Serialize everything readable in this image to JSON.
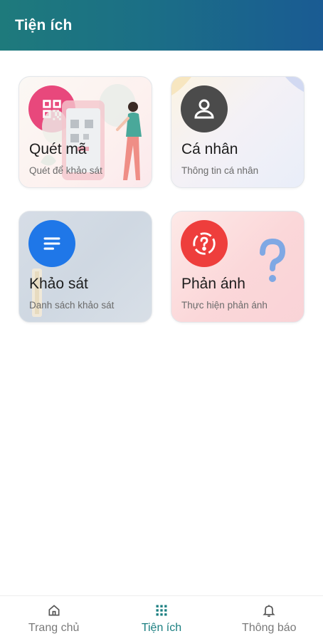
{
  "header": {
    "title": "Tiện ích"
  },
  "cards": [
    {
      "title": "Quét mã",
      "subtitle": "Quét để khảo sát",
      "icon": "qr-code-icon",
      "color": "#e8487c"
    },
    {
      "title": "Cá nhân",
      "subtitle": "Thông tin cá nhân",
      "icon": "user-icon",
      "color": "#4b4b4b"
    },
    {
      "title": "Khảo sát",
      "subtitle": "Danh sách khảo sát",
      "icon": "list-icon",
      "color": "#1f77e8"
    },
    {
      "title": "Phản ánh",
      "subtitle": "Thực hiện phản ánh",
      "icon": "question-icon",
      "color": "#ee3e3c"
    }
  ],
  "bottom_nav": {
    "items": [
      {
        "label": "Trang chủ",
        "icon": "home-icon",
        "active": false
      },
      {
        "label": "Tiện ích",
        "icon": "grid-icon",
        "active": true
      },
      {
        "label": "Thông báo",
        "icon": "bell-icon",
        "active": false
      }
    ]
  },
  "colors": {
    "header_start": "#1e7a7c",
    "header_end": "#1a5b93",
    "nav_active": "#1a7e80",
    "nav_inactive": "#7a7a7a"
  }
}
